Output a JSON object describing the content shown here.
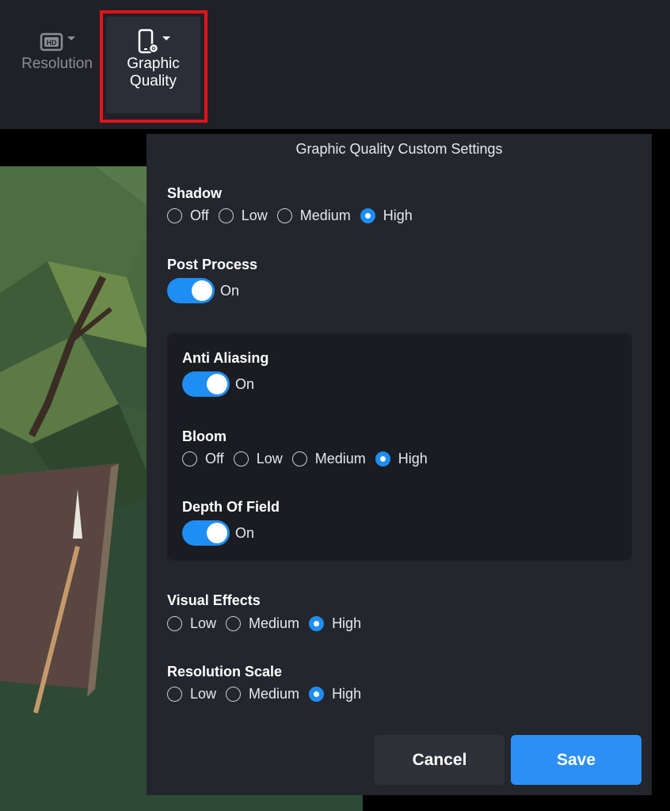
{
  "toolbar": {
    "resolution": {
      "label": "Resolution",
      "icon": "hd-icon"
    },
    "graphic_quality": {
      "label_line1": "Graphic",
      "label_line2": "Quality",
      "icon": "phone-gear-icon"
    }
  },
  "dialog": {
    "title": "Graphic Quality Custom Settings",
    "shadow": {
      "label": "Shadow",
      "options": [
        "Off",
        "Low",
        "Medium",
        "High"
      ],
      "selected": "High"
    },
    "post_process": {
      "label": "Post Process",
      "state": "On"
    },
    "anti_aliasing": {
      "label": "Anti Aliasing",
      "state": "On"
    },
    "bloom": {
      "label": "Bloom",
      "options": [
        "Off",
        "Low",
        "Medium",
        "High"
      ],
      "selected": "High"
    },
    "depth_of_field": {
      "label": "Depth Of Field",
      "state": "On"
    },
    "visual_effects": {
      "label": "Visual Effects",
      "options": [
        "Low",
        "Medium",
        "High"
      ],
      "selected": "High"
    },
    "resolution_scale": {
      "label": "Resolution Scale",
      "options": [
        "Low",
        "Medium",
        "High"
      ],
      "selected": "High"
    },
    "cancel_label": "Cancel",
    "save_label": "Save"
  },
  "colors": {
    "accent": "#1e8ef5",
    "highlight": "#e1141b",
    "panel": "#23262d",
    "toolbar": "#1f2127"
  }
}
